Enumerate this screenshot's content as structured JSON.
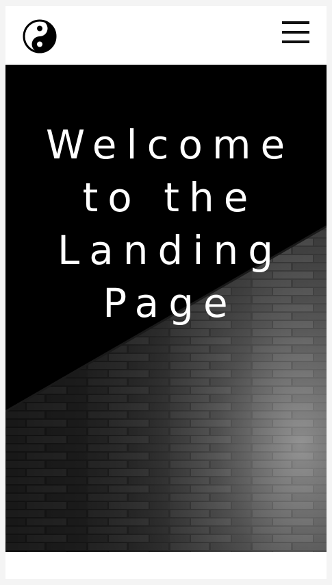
{
  "header": {
    "logo_icon": "yin-yang-icon",
    "menu_icon": "hamburger-menu-icon"
  },
  "hero": {
    "title": "Welcome to the Landing Page",
    "background": "dark-brick-pavement-photo"
  },
  "colors": {
    "header_bg": "#ffffff",
    "hero_bg": "#000000",
    "title_text": "#ffffff",
    "icon": "#111111"
  }
}
